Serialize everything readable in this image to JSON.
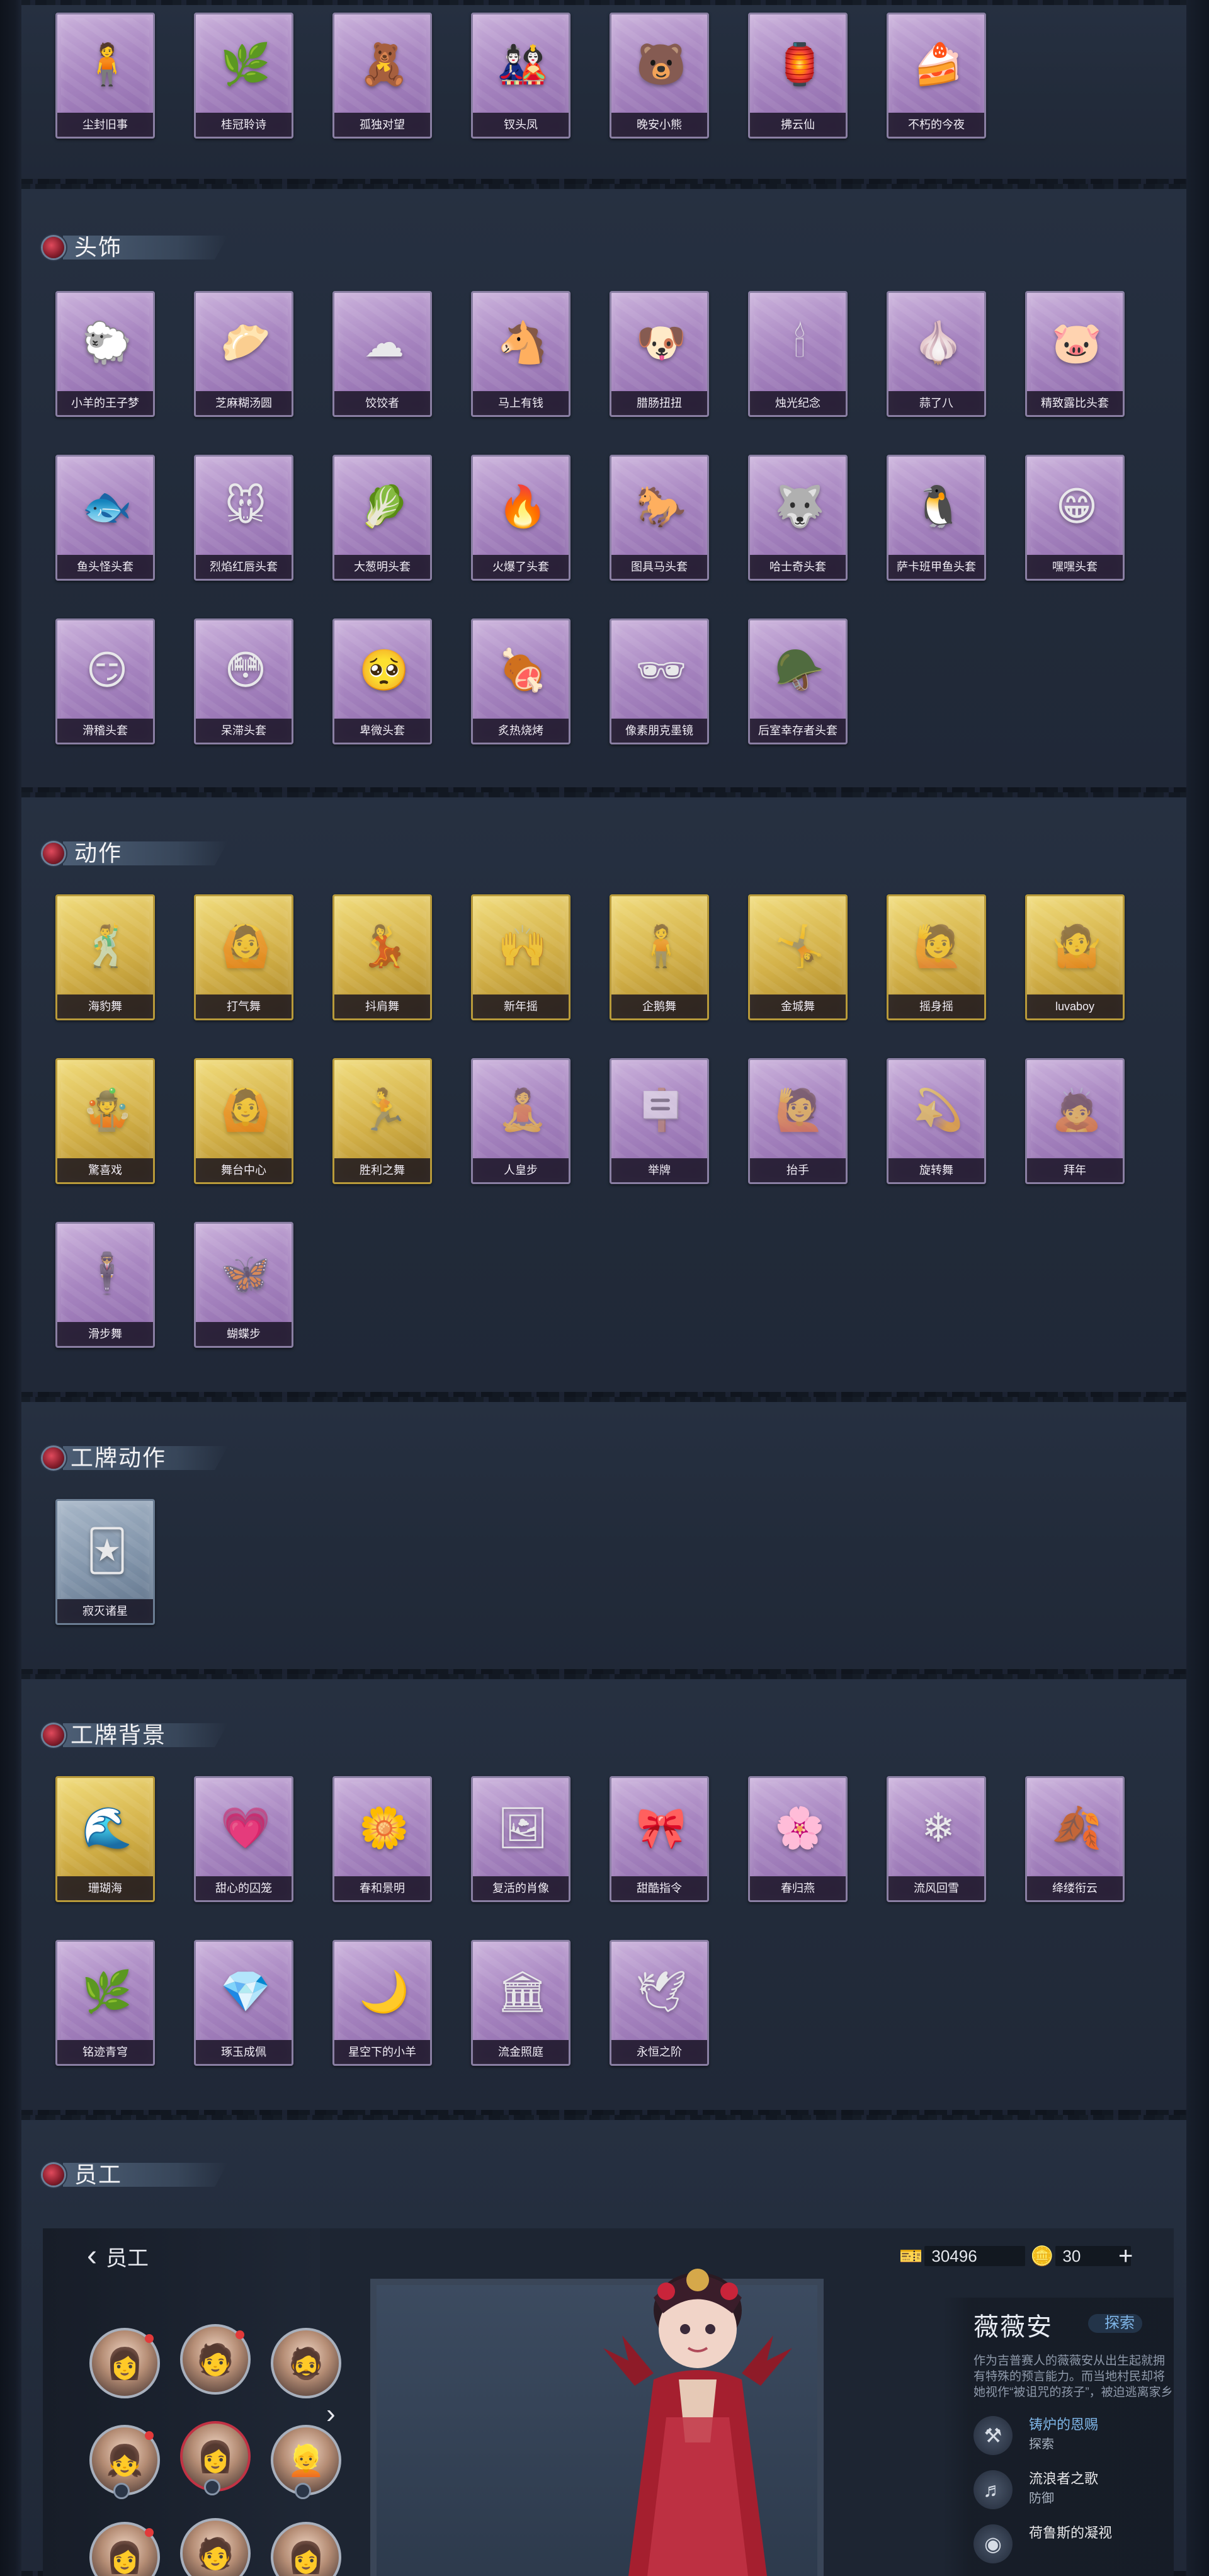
{
  "colors": {
    "panel_bg": "#242d3c",
    "card_purple": "#a785c0",
    "card_gold": "#d4b24a",
    "card_blue": "#7f92a8",
    "accent_red": "#c23244",
    "link_blue": "#7fb6e8"
  },
  "sections": {
    "top_row": {
      "items": [
        {
          "name": "尘封旧事",
          "icon": "figure-icon",
          "glyph": "🧍"
        },
        {
          "name": "桂冠聆诗",
          "icon": "plant-charm-icon",
          "glyph": "🌿"
        },
        {
          "name": "孤独对望",
          "icon": "charm-icon",
          "glyph": "🧸"
        },
        {
          "name": "钗头凤",
          "icon": "doll-icon",
          "glyph": "🎎"
        },
        {
          "name": "晚安小熊",
          "icon": "bear-icon",
          "glyph": "🐻"
        },
        {
          "name": "拂云仙",
          "icon": "ornament-icon",
          "glyph": "🏮"
        },
        {
          "name": "不朽的今夜",
          "icon": "cake-icon",
          "glyph": "🍰"
        }
      ]
    },
    "headwear": {
      "title": "头饰",
      "items": [
        {
          "name": "小羊的王子梦",
          "icon": "sheep-icon",
          "glyph": "🐑"
        },
        {
          "name": "芝麻糊汤圆",
          "icon": "dumpling-icon",
          "glyph": "🥟"
        },
        {
          "name": "饺饺者",
          "icon": "dumpling-cloud-icon",
          "glyph": "☁"
        },
        {
          "name": "马上有钱",
          "icon": "horse-icon",
          "glyph": "🐴"
        },
        {
          "name": "腊肠扭扭",
          "icon": "dog-icon",
          "glyph": "🐶"
        },
        {
          "name": "烛光纪念",
          "icon": "candle-icon",
          "glyph": "🕯"
        },
        {
          "name": "蒜了八",
          "icon": "garlic-icon",
          "glyph": "🧄"
        },
        {
          "name": "精致露比头套",
          "icon": "pig-icon",
          "glyph": "🐷"
        },
        {
          "name": "鱼头怪头套",
          "icon": "fish-icon",
          "glyph": "🐟"
        },
        {
          "name": "烈焰红唇头套",
          "icon": "pikachu-icon",
          "glyph": "🐭"
        },
        {
          "name": "大葱明头套",
          "icon": "scallion-icon",
          "glyph": "🥬"
        },
        {
          "name": "火爆了头套",
          "icon": "fire-icon",
          "glyph": "🔥"
        },
        {
          "name": "图具马头套",
          "icon": "horse-head-icon",
          "glyph": "🐎"
        },
        {
          "name": "哈士奇头套",
          "icon": "husky-icon",
          "glyph": "🐺"
        },
        {
          "name": "萨卡班甲鱼头套",
          "icon": "fish-head-icon",
          "glyph": "🐧"
        },
        {
          "name": "嘿嘿头套",
          "icon": "grin-icon",
          "glyph": "😁"
        },
        {
          "name": "滑稽头套",
          "icon": "smirk-icon",
          "glyph": "😏"
        },
        {
          "name": "呆滞头套",
          "icon": "stare-icon",
          "glyph": "😳"
        },
        {
          "name": "卑微头套",
          "icon": "humble-icon",
          "glyph": "🥺"
        },
        {
          "name": "炙热烧烤",
          "icon": "grill-icon",
          "glyph": "🍖"
        },
        {
          "name": "像素朋克墨镜",
          "icon": "sunglasses-icon",
          "glyph": "🕶"
        },
        {
          "name": "后室幸存者头套",
          "icon": "gasmask-icon",
          "glyph": "🪖"
        }
      ]
    },
    "actions": {
      "title": "动作",
      "items": [
        {
          "name": "海豹舞",
          "tier": "gold",
          "icon": "pose-icon",
          "glyph": "🕺"
        },
        {
          "name": "打气舞",
          "tier": "gold",
          "icon": "pose-icon",
          "glyph": "🙆"
        },
        {
          "name": "抖肩舞",
          "tier": "gold",
          "icon": "pose-icon",
          "glyph": "💃"
        },
        {
          "name": "新年摇",
          "tier": "gold",
          "icon": "pose-icon",
          "glyph": "🙌"
        },
        {
          "name": "企鹅舞",
          "tier": "gold",
          "icon": "pose-icon",
          "glyph": "🧍"
        },
        {
          "name": "金城舞",
          "tier": "gold",
          "icon": "pose-icon",
          "glyph": "🤸"
        },
        {
          "name": "摇身摇",
          "tier": "gold",
          "icon": "pose-icon",
          "glyph": "🙋"
        },
        {
          "name": "luvaboy",
          "tier": "gold",
          "icon": "pose-icon",
          "glyph": "🤷"
        },
        {
          "name": "驚喜戏",
          "tier": "gold",
          "icon": "pose-icon",
          "glyph": "🤹"
        },
        {
          "name": "舞台中心",
          "tier": "gold",
          "icon": "pose-icon",
          "glyph": "🙆"
        },
        {
          "name": "胜利之舞",
          "tier": "gold",
          "icon": "pose-icon",
          "glyph": "🏃"
        },
        {
          "name": "人皇步",
          "tier": "purple",
          "icon": "pose-icon",
          "glyph": "🧘"
        },
        {
          "name": "举牌",
          "tier": "purple",
          "icon": "sign-pose-icon",
          "glyph": "🪧"
        },
        {
          "name": "抬手",
          "tier": "purple",
          "icon": "pose-icon",
          "glyph": "🙋"
        },
        {
          "name": "旋转舞",
          "tier": "purple",
          "icon": "pose-icon",
          "glyph": "💫"
        },
        {
          "name": "拜年",
          "tier": "purple",
          "icon": "pose-icon",
          "glyph": "🙇"
        },
        {
          "name": "滑步舞",
          "tier": "purple",
          "icon": "pose-icon",
          "glyph": "🕴"
        },
        {
          "name": "蝴蝶步",
          "tier": "purple",
          "icon": "pose-icon",
          "glyph": "🦋"
        }
      ]
    },
    "badge_actions": {
      "title": "工牌动作",
      "items": [
        {
          "name": "寂灭诸星",
          "tier": "blue",
          "icon": "badge-card-icon",
          "glyph": "🃏"
        }
      ]
    },
    "badge_backgrounds": {
      "title": "工牌背景",
      "items": [
        {
          "name": "珊瑚海",
          "tier": "gold",
          "icon": "card-icon",
          "glyph": "🌊"
        },
        {
          "name": "甜心的囚笼",
          "tier": "purple",
          "icon": "card-icon",
          "glyph": "💗"
        },
        {
          "name": "春和景明",
          "tier": "purple",
          "icon": "card-icon",
          "glyph": "🌼"
        },
        {
          "name": "复活的肖像",
          "tier": "purple",
          "icon": "card-icon",
          "glyph": "🖼"
        },
        {
          "name": "甜酷指令",
          "tier": "purple",
          "icon": "card-icon",
          "glyph": "🎀"
        },
        {
          "name": "春归燕",
          "tier": "purple",
          "icon": "card-icon",
          "glyph": "🌸"
        },
        {
          "name": "流风回雪",
          "tier": "purple",
          "icon": "card-icon",
          "glyph": "❄"
        },
        {
          "name": "绛缕衔云",
          "tier": "purple",
          "icon": "card-icon",
          "glyph": "🍂"
        },
        {
          "name": "铭迹青穹",
          "tier": "purple",
          "icon": "card-icon",
          "glyph": "🌿"
        },
        {
          "name": "琢玉成佩",
          "tier": "purple",
          "icon": "card-icon",
          "glyph": "💎"
        },
        {
          "name": "星空下的小羊",
          "tier": "purple",
          "icon": "card-icon",
          "glyph": "🌙"
        },
        {
          "name": "流金照庭",
          "tier": "purple",
          "icon": "card-icon",
          "glyph": "🏛"
        },
        {
          "name": "永恒之阶",
          "tier": "purple",
          "icon": "card-icon",
          "glyph": "🕊"
        }
      ]
    },
    "employees": {
      "title": "员工"
    }
  },
  "employee_screen": {
    "back_label": "员工",
    "currency_a": {
      "value": "30496",
      "icon": "ticket-icon"
    },
    "currency_b": {
      "value": "30",
      "icon": "gold-icon"
    },
    "character": {
      "name": "薇薇安",
      "tag": "探索",
      "description": "作为吉普赛人的薇薇安从出生起就拥有特殊的预言能力。而当地村民却将她视作“被诅咒的孩子”，被迫逃离家乡的薇薇安……"
    },
    "traits": [
      {
        "name": "铸炉的恩赐",
        "type": "探索",
        "icon": "forge-icon"
      },
      {
        "name": "流浪者之歌",
        "type": "防御",
        "icon": "song-icon"
      },
      {
        "name": "荷鲁斯的凝视",
        "type": "",
        "icon": "eye-icon"
      }
    ]
  }
}
